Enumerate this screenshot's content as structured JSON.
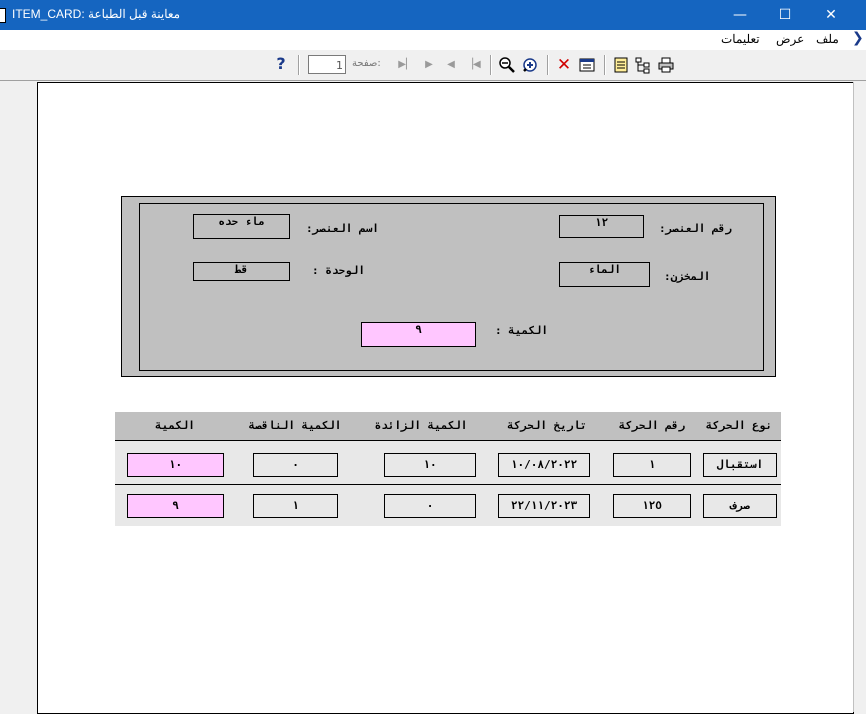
{
  "window": {
    "title": "ITEM_CARD: معاينة قبل الطباعة",
    "minimize": "—",
    "maximize": "☐",
    "close": "✕"
  },
  "menu": {
    "items": [
      "ملف",
      "عرض",
      "تعليمات"
    ]
  },
  "toolbar": {
    "page_label": "صفحة:",
    "page_value": "1",
    "help": "?",
    "icons": [
      "help-icon",
      "first-page-icon",
      "prev-page-icon",
      "next-page-icon",
      "last-page-icon",
      "zoom-out-icon",
      "zoom-in-icon",
      "close-preview-icon",
      "page-setup-icon",
      "export-icon",
      "tree-icon",
      "print-icon"
    ]
  },
  "card": {
    "item_no_label": "رقم العنصر:",
    "item_no_value": "١٢",
    "item_name_label": "اسم العنصر:",
    "item_name_value": "ماء حده",
    "store_label": "المخزن:",
    "store_value": "الماء",
    "unit_label": "الوحدة :",
    "unit_value": "قط",
    "qty_label": "الكمية :",
    "qty_value": "٩"
  },
  "table": {
    "headers": [
      "نوع الحركة",
      "رقم الحركة",
      "تاريخ الحركة",
      "الكمية الزائدة",
      "الكمية الناقصة",
      "الكمية"
    ],
    "rows": [
      [
        "استقبال",
        "١",
        "١٠/٠٨/٢٠٢٢",
        "١٠",
        "٠",
        "١٠"
      ],
      [
        "صرف",
        "١٢٥",
        "٢٢/١١/٢٠٢٣",
        "٠",
        "١",
        "٩"
      ]
    ]
  }
}
